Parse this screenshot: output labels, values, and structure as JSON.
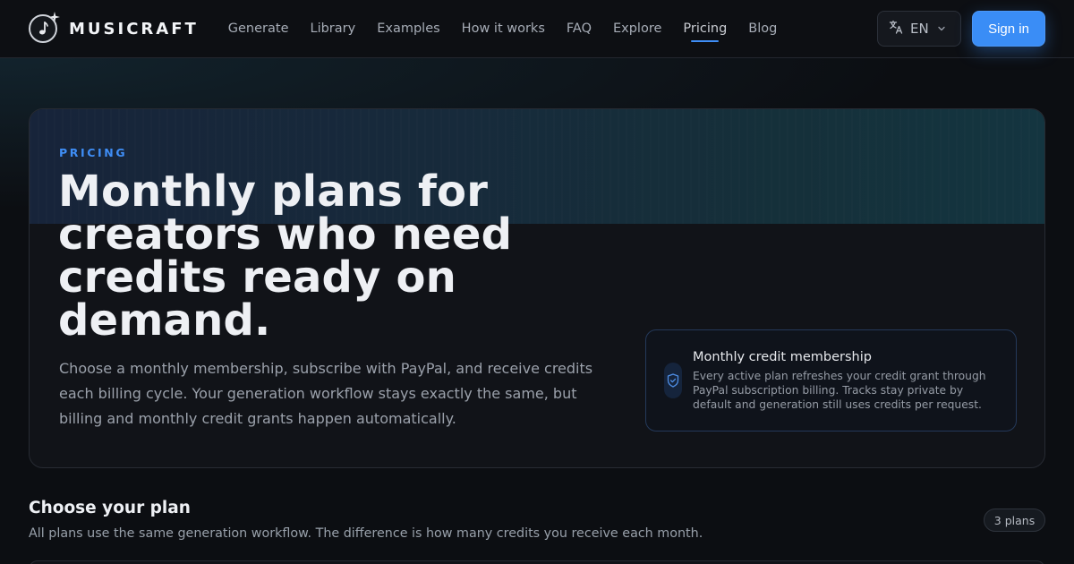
{
  "brand": {
    "name": "MUSICRAFT",
    "logo_icon": "music-note-sparkle-icon"
  },
  "nav": {
    "items": [
      {
        "label": "Generate"
      },
      {
        "label": "Library"
      },
      {
        "label": "Examples"
      },
      {
        "label": "How it works"
      },
      {
        "label": "FAQ"
      },
      {
        "label": "Explore"
      },
      {
        "label": "Pricing",
        "active": true
      },
      {
        "label": "Blog"
      }
    ]
  },
  "header": {
    "language": {
      "code": "EN",
      "icon": "translate-icon",
      "chevron": "chevron-down-icon"
    },
    "signin_label": "Sign in"
  },
  "hero": {
    "eyebrow": "PRICING",
    "title": "Monthly plans for creators who need credits ready on demand.",
    "description": "Choose a monthly membership, subscribe with PayPal, and receive credits each billing cycle. Your generation workflow stays exactly the same, but billing and monthly credit grants happen automatically.",
    "membership": {
      "icon": "shield-check-icon",
      "title": "Monthly credit membership",
      "body": "Every active plan refreshes your credit grant through PayPal subscription billing. Tracks stay private by default and generation still uses credits per request."
    }
  },
  "plans": {
    "title": "Choose your plan",
    "subtitle": "All plans use the same generation workflow. The difference is how many credits you receive each month.",
    "count_badge": "3 plans"
  },
  "colors": {
    "accent": "#3a8df6",
    "background": "#0c0e12",
    "card": "#111318"
  }
}
